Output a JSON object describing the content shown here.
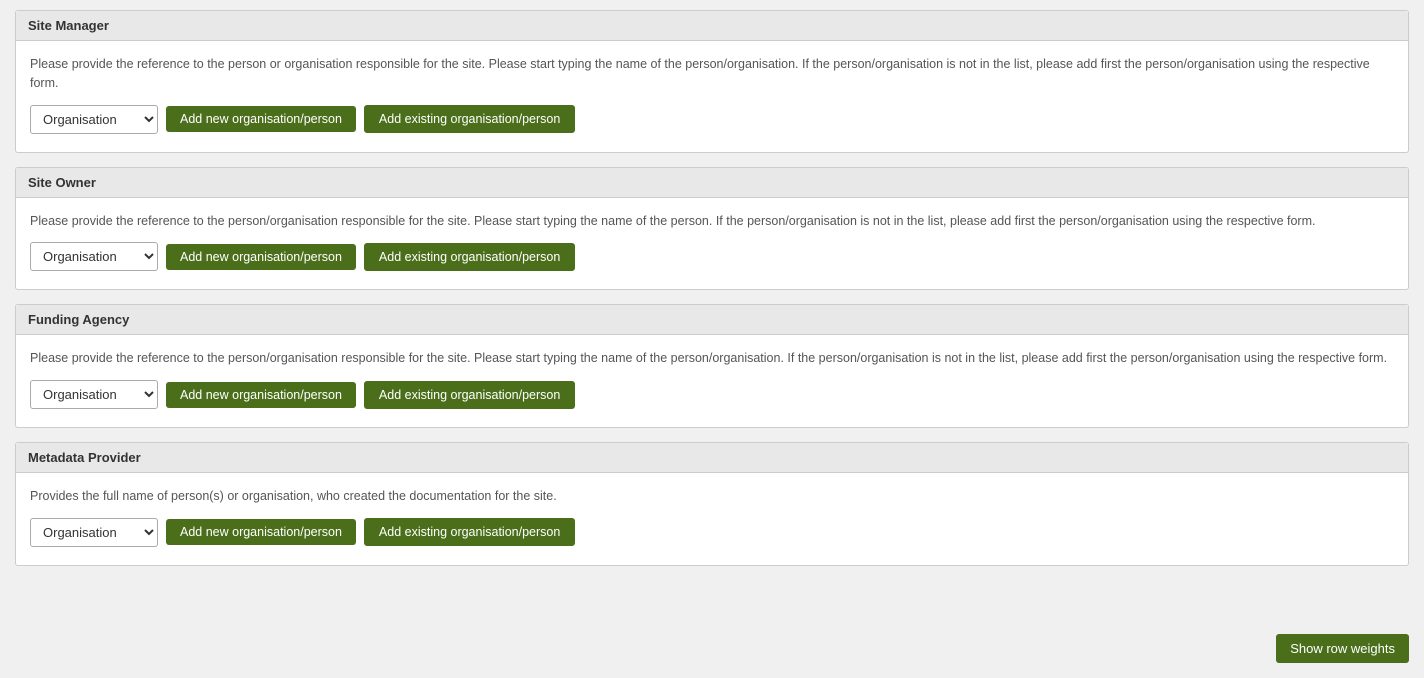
{
  "sections": [
    {
      "id": "site-manager",
      "title": "Site Manager",
      "description": "Please provide the reference to the person or organisation responsible for the site. Please start typing the name of the person/organisation. If the person/organisation is not in the list, please add first the person/organisation using the respective form.",
      "dropdown_value": "Organisation",
      "btn_add_new": "Add new organisation/person",
      "btn_add_existing": "Add existing organisation/person"
    },
    {
      "id": "site-owner",
      "title": "Site Owner",
      "description": "Please provide the reference to the person/organisation responsible for the site. Please start typing the name of the person. If the person/organisation is not in the list, please add first the person/organisation using the respective form.",
      "dropdown_value": "Organisation",
      "btn_add_new": "Add new organisation/person",
      "btn_add_existing": "Add existing organisation/person"
    },
    {
      "id": "funding-agency",
      "title": "Funding Agency",
      "description": "Please provide the reference to the person/organisation responsible for the site. Please start typing the name of the person/organisation. If the person/organisation is not in the list, please add first the person/organisation using the respective form.",
      "dropdown_value": "Organisation",
      "btn_add_new": "Add new organisation/person",
      "btn_add_existing": "Add existing organisation/person"
    },
    {
      "id": "metadata-provider",
      "title": "Metadata Provider",
      "description": "Provides the full name of person(s) or organisation, who created the documentation for the site.",
      "dropdown_value": "Organisation",
      "btn_add_new": "Add new organisation/person",
      "btn_add_existing": "Add existing organisation/person"
    }
  ],
  "show_row_weights_label": "Show row weights"
}
